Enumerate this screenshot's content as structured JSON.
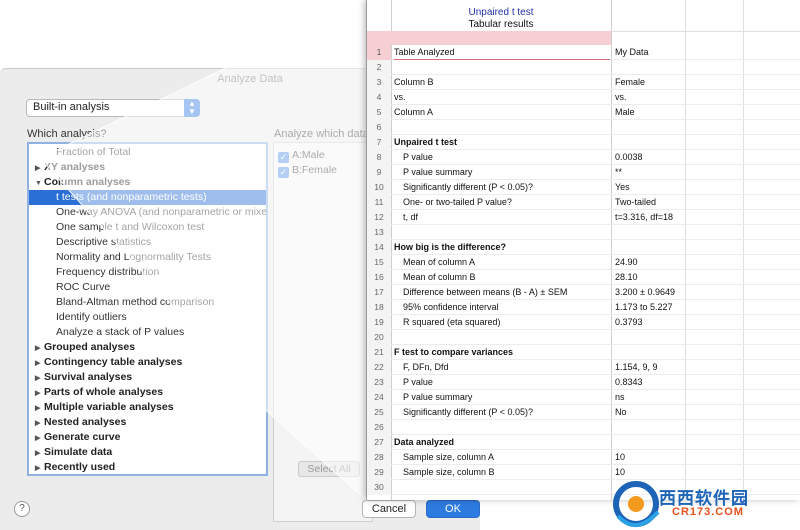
{
  "dialog": {
    "title": "Analyze Data",
    "select_value": "Built-in analysis",
    "which_analysis_label": "Which analysis?",
    "which_data_label": "Analyze which data",
    "tree": [
      {
        "label": "Fraction of Total",
        "kind": "child"
      },
      {
        "label": "XY analyses",
        "kind": "group",
        "expanded": false
      },
      {
        "label": "Column analyses",
        "kind": "group",
        "expanded": true
      },
      {
        "label": "t tests (and nonparametric tests)",
        "kind": "child",
        "selected": true
      },
      {
        "label": "One-way ANOVA (and nonparametric or mixed)",
        "kind": "child"
      },
      {
        "label": "One sample t and Wilcoxon test",
        "kind": "child"
      },
      {
        "label": "Descriptive statistics",
        "kind": "child"
      },
      {
        "label": "Normality and Lognormality Tests",
        "kind": "child"
      },
      {
        "label": "Frequency distribution",
        "kind": "child"
      },
      {
        "label": "ROC Curve",
        "kind": "child"
      },
      {
        "label": "Bland-Altman method comparison",
        "kind": "child"
      },
      {
        "label": "Identify outliers",
        "kind": "child"
      },
      {
        "label": "Analyze a stack of P values",
        "kind": "child"
      },
      {
        "label": "Grouped analyses",
        "kind": "group",
        "expanded": false
      },
      {
        "label": "Contingency table analyses",
        "kind": "group",
        "expanded": false
      },
      {
        "label": "Survival analyses",
        "kind": "group",
        "expanded": false
      },
      {
        "label": "Parts of whole analyses",
        "kind": "group",
        "expanded": false
      },
      {
        "label": "Multiple variable analyses",
        "kind": "group",
        "expanded": false
      },
      {
        "label": "Nested analyses",
        "kind": "group",
        "expanded": false
      },
      {
        "label": "Generate curve",
        "kind": "group",
        "expanded": false
      },
      {
        "label": "Simulate data",
        "kind": "group",
        "expanded": false
      },
      {
        "label": "Recently used",
        "kind": "group",
        "expanded": false
      }
    ],
    "datasets": [
      "A:Male",
      "B:Female"
    ],
    "select_all_label": "Select All",
    "help_label": "?",
    "cancel_label": "Cancel",
    "ok_label": "OK"
  },
  "sheet": {
    "title": "Unpaired t test",
    "subtitle": "Tabular results",
    "rows": [
      {
        "n": "1",
        "label": "Table Analyzed",
        "value": "My Data",
        "style": "plain"
      },
      {
        "n": "2",
        "label": "",
        "value": "",
        "style": "plain"
      },
      {
        "n": "3",
        "label": "Column B",
        "value": "Female",
        "style": "plain"
      },
      {
        "n": "4",
        "label": "vs.",
        "value": "vs.",
        "style": "plain"
      },
      {
        "n": "5",
        "label": "Column A",
        "value": "Male",
        "style": "plain"
      },
      {
        "n": "6",
        "label": "",
        "value": "",
        "style": "plain"
      },
      {
        "n": "7",
        "label": "Unpaired t test",
        "value": "",
        "style": "bold"
      },
      {
        "n": "8",
        "label": "P value",
        "value": "0.0038",
        "style": "indent"
      },
      {
        "n": "9",
        "label": "P value summary",
        "value": "**",
        "style": "indent"
      },
      {
        "n": "10",
        "label": "Significantly different (P < 0.05)?",
        "value": "Yes",
        "style": "indent"
      },
      {
        "n": "11",
        "label": "One- or two-tailed P value?",
        "value": "Two-tailed",
        "style": "indent"
      },
      {
        "n": "12",
        "label": "t, df",
        "value": "t=3.316, df=18",
        "style": "indent"
      },
      {
        "n": "13",
        "label": "",
        "value": "",
        "style": "plain"
      },
      {
        "n": "14",
        "label": "How big is the difference?",
        "value": "",
        "style": "bold"
      },
      {
        "n": "15",
        "label": "Mean of column A",
        "value": "24.90",
        "style": "indent"
      },
      {
        "n": "16",
        "label": "Mean of column B",
        "value": "28.10",
        "style": "indent"
      },
      {
        "n": "17",
        "label": "Difference between means (B - A) ± SEM",
        "value": "3.200 ± 0.9649",
        "style": "indent"
      },
      {
        "n": "18",
        "label": "95% confidence interval",
        "value": "1.173 to 5.227",
        "style": "indent"
      },
      {
        "n": "19",
        "label": "R squared (eta squared)",
        "value": "0.3793",
        "style": "indent"
      },
      {
        "n": "20",
        "label": "",
        "value": "",
        "style": "plain"
      },
      {
        "n": "21",
        "label": "F test to compare variances",
        "value": "",
        "style": "bold"
      },
      {
        "n": "22",
        "label": "F, DFn, Dfd",
        "value": "1.154, 9, 9",
        "style": "indent"
      },
      {
        "n": "23",
        "label": "P value",
        "value": "0.8343",
        "style": "indent"
      },
      {
        "n": "24",
        "label": "P value summary",
        "value": "ns",
        "style": "indent"
      },
      {
        "n": "25",
        "label": "Significantly different (P < 0.05)?",
        "value": "No",
        "style": "indent"
      },
      {
        "n": "26",
        "label": "",
        "value": "",
        "style": "plain"
      },
      {
        "n": "27",
        "label": "Data analyzed",
        "value": "",
        "style": "bold"
      },
      {
        "n": "28",
        "label": "Sample size, column A",
        "value": "10",
        "style": "indent"
      },
      {
        "n": "29",
        "label": "Sample size, column B",
        "value": "10",
        "style": "indent"
      },
      {
        "n": "30",
        "label": "",
        "value": "",
        "style": "plain"
      }
    ]
  },
  "watermark": {
    "text": "西西软件园",
    "sub": "CR173.COM"
  },
  "colors": {
    "accent": "#2a6fd6",
    "ok_button": "#2d7be0",
    "pink_band": "#f6cfd2",
    "title_blue": "#2233aa"
  }
}
